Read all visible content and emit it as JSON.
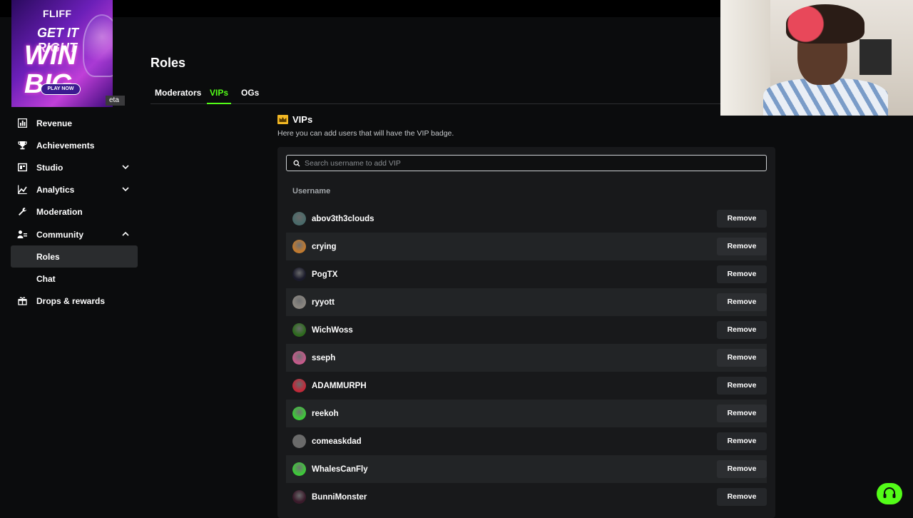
{
  "ad": {
    "brand": "FLIFF",
    "line1": "GET IT RIGHT",
    "line2": "WIN BIG",
    "cta": "PLAY NOW"
  },
  "beta_badge": "eta",
  "sidebar": {
    "items": [
      {
        "label": "Revenue",
        "icon": "bar-chart-icon"
      },
      {
        "label": "Achievements",
        "icon": "trophy-icon"
      },
      {
        "label": "Studio",
        "icon": "studio-icon",
        "expandable": true
      },
      {
        "label": "Analytics",
        "icon": "analytics-icon",
        "expandable": true
      },
      {
        "label": "Moderation",
        "icon": "wrench-icon"
      },
      {
        "label": "Community",
        "icon": "community-icon",
        "expanded": true
      },
      {
        "label": "Roles",
        "sub": true,
        "active": true
      },
      {
        "label": "Chat",
        "sub": true
      },
      {
        "label": "Drops & rewards",
        "icon": "gift-icon"
      }
    ]
  },
  "page": {
    "title": "Roles",
    "tabs": [
      {
        "label": "Moderators",
        "active": false
      },
      {
        "label": "VIPs",
        "active": true
      },
      {
        "label": "OGs",
        "active": false
      }
    ]
  },
  "vips": {
    "title": "VIPs",
    "description": "Here you can add users that will have the VIP badge.",
    "search_placeholder": "Search username to add VIP",
    "column_header": "Username",
    "remove_label": "Remove",
    "users": [
      {
        "name": "abov3th3clouds",
        "avatar_color": "#4a6a6a"
      },
      {
        "name": "crying",
        "avatar_color": "#c07a30"
      },
      {
        "name": "PogTX",
        "avatar_color": "#1a1a2a"
      },
      {
        "name": "ryyott",
        "avatar_color": "#8a8680"
      },
      {
        "name": "WichWoss",
        "avatar_color": "#2e6a1e"
      },
      {
        "name": "sseph",
        "avatar_color": "#c45a8a"
      },
      {
        "name": "ADAMMURPH",
        "avatar_color": "#c02a3a"
      },
      {
        "name": "reekoh",
        "avatar_color": "#3ec83a"
      },
      {
        "name": "comeaskdad",
        "avatar_color": "#6a6a6a"
      },
      {
        "name": "WhalesCanFly",
        "avatar_color": "#3ec83a"
      },
      {
        "name": "BunniMonster",
        "avatar_color": "#3a1a2a"
      }
    ]
  },
  "colors": {
    "accent": "#53fc18",
    "background": "#0b0c0d",
    "panel": "#18191b"
  }
}
